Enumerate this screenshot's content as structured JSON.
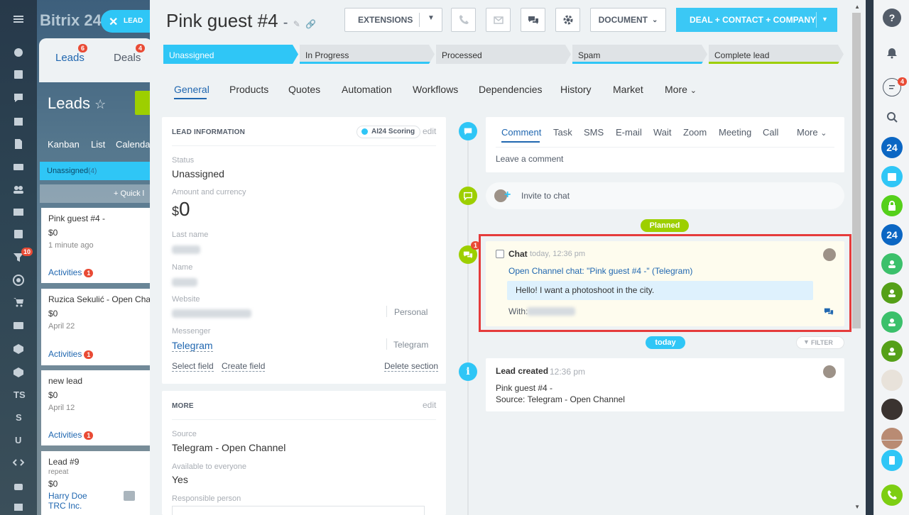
{
  "board": {
    "logo": "Bitrix 24",
    "lead_pill": "LEAD",
    "tabs": [
      {
        "label": "Leads",
        "badge": "6"
      },
      {
        "label": "Deals",
        "badge": "4"
      }
    ],
    "heading": "Leads",
    "views": [
      "Kanban",
      "List",
      "Calenda"
    ],
    "column": {
      "label": "Unassigned",
      "count": "(4)"
    },
    "quick_add": "+ Quick l",
    "cards": [
      {
        "title": "Pink guest #4 -",
        "amount": "$0",
        "date": "1 minute ago",
        "activities": "Activities",
        "badge": "1"
      },
      {
        "title": "Ruzica Sekulić - Open Cha",
        "amount": "$0",
        "date": "April 22",
        "activities": "Activities",
        "badge": "1"
      },
      {
        "title": "new lead",
        "amount": "$0",
        "date": "April 12",
        "activities": "Activities",
        "badge": "1"
      },
      {
        "title": "Lead #9",
        "sub": "repeat",
        "amount": "$0",
        "person": "Harry Doe",
        "company": "TRC Inc."
      }
    ]
  },
  "leftnav": {
    "badge_filter": "10",
    "labels": [
      "TS",
      "S",
      "U"
    ]
  },
  "header": {
    "title": "Pink guest #4",
    "title_suffix": "-",
    "extensions": "EXTENSIONS",
    "document": "DOCUMENT",
    "deal_button": "DEAL + CONTACT + COMPANY"
  },
  "stages": [
    {
      "label": "Unassigned",
      "color": "#2fc6f6",
      "active": true
    },
    {
      "label": "In Progress",
      "color": "#2fc6f6"
    },
    {
      "label": "Processed",
      "color": "#dfe3e6"
    },
    {
      "label": "Spam",
      "color": "#2fc6f6"
    },
    {
      "label": "Complete lead",
      "color": "#9dcf00"
    }
  ],
  "tabs": [
    "General",
    "Products",
    "Quotes",
    "Automation",
    "Workflows",
    "Dependencies",
    "History",
    "Market",
    "More"
  ],
  "lead_info": {
    "title": "LEAD INFORMATION",
    "scoring": "AI24 Scoring",
    "edit": "edit",
    "status_label": "Status",
    "status_value": "Unassigned",
    "amount_label": "Amount and currency",
    "amount_currency": "$",
    "amount_value": "0",
    "last_name_label": "Last name",
    "name_label": "Name",
    "website_label": "Website",
    "website_type": "Personal",
    "messenger_label": "Messenger",
    "messenger_value": "Telegram",
    "messenger_type": "Telegram",
    "select_field": "Select field",
    "create_field": "Create field",
    "delete_section": "Delete section"
  },
  "more_section": {
    "title": "MORE",
    "edit": "edit",
    "source_label": "Source",
    "source_value": "Telegram - Open Channel",
    "available_label": "Available to everyone",
    "available_value": "Yes",
    "responsible_label": "Responsible person"
  },
  "timeline": {
    "comment_tabs": [
      "Comment",
      "Task",
      "SMS",
      "E-mail",
      "Wait",
      "Zoom",
      "Meeting",
      "Call",
      "More"
    ],
    "comment_placeholder": "Leave a comment",
    "invite": "Invite to chat",
    "planned": "Planned",
    "chat": {
      "title": "Chat",
      "time": "today, 12:36 pm",
      "badge": "1",
      "link": "Open Channel chat: \"Pink guest #4 -\" (Telegram)",
      "message": "Hello! I want a photoshoot in the city.",
      "with_label": "With:"
    },
    "today": "today",
    "filter": "FILTER",
    "created": {
      "title": "Lead created",
      "time": "12:36 pm",
      "line1": "Pink guest #4 -",
      "line2": "Source: Telegram - Open Channel"
    }
  },
  "rightbar": {
    "badge": "4",
    "b24": "24"
  },
  "colors": {
    "accent": "#2fc6f6",
    "green": "#9dcf00",
    "highlight": "#e53b3b",
    "link": "#2067b0"
  }
}
